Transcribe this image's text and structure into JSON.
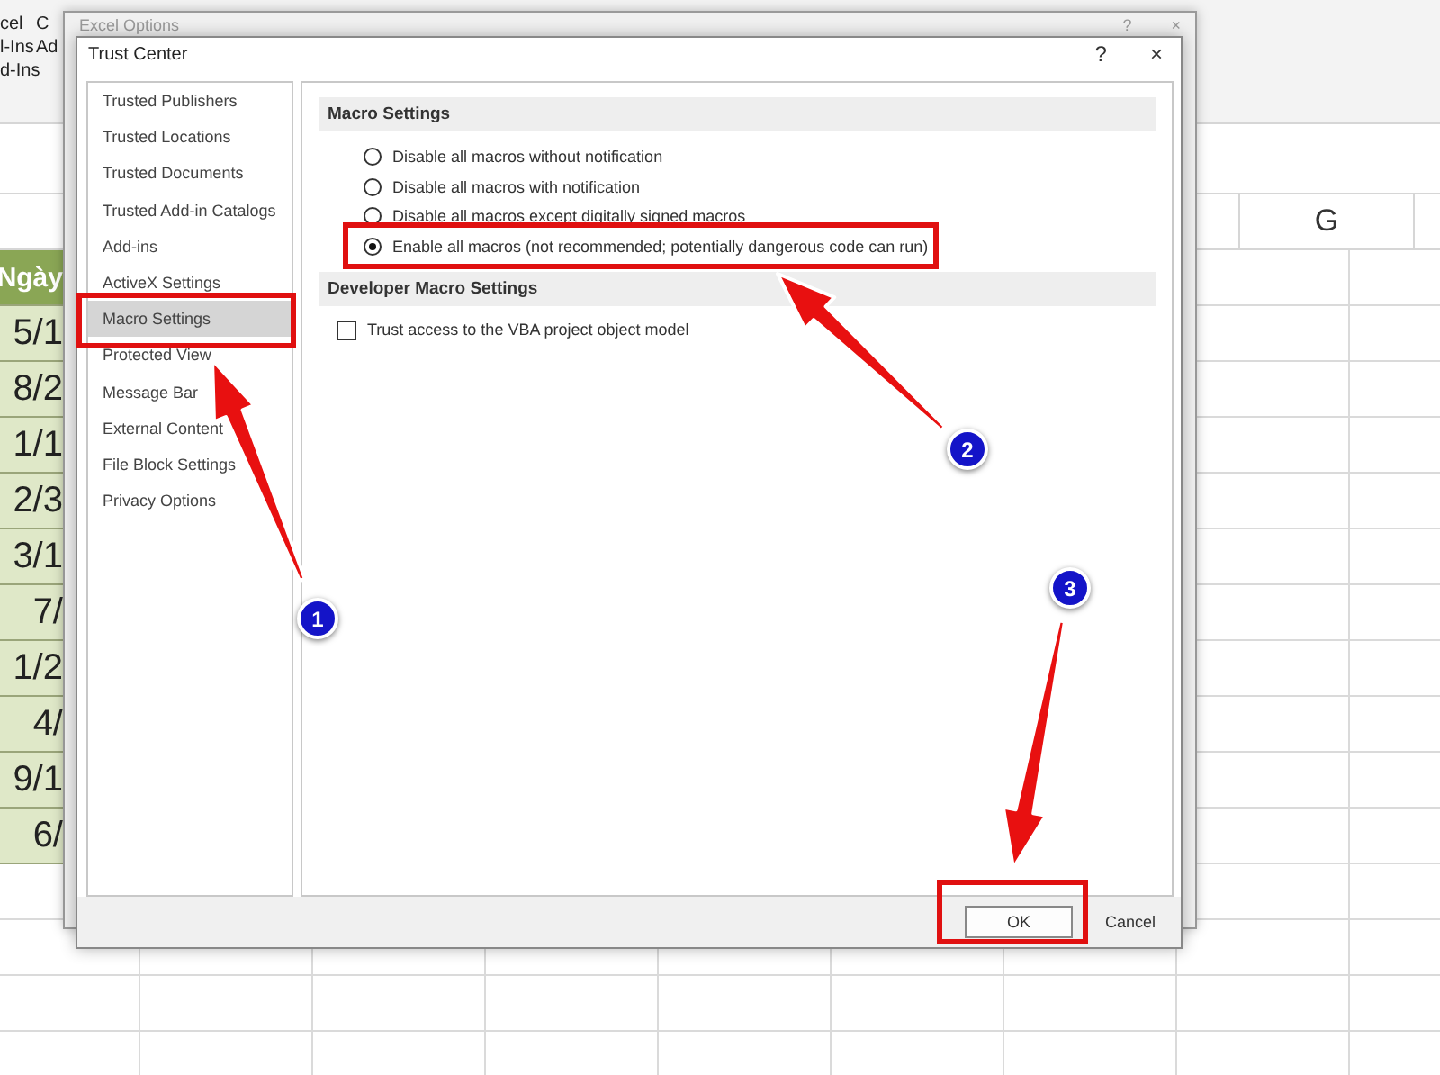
{
  "excel": {
    "ribbon_labels": [
      "cel",
      "C",
      "l-Ins",
      "Ad",
      "d-Ins"
    ],
    "column_header": "G",
    "cells": [
      {
        "text": "Ngày",
        "kind": "header"
      },
      {
        "text": "5/1",
        "kind": "value"
      },
      {
        "text": "8/2",
        "kind": "value"
      },
      {
        "text": "1/1",
        "kind": "value"
      },
      {
        "text": "2/3",
        "kind": "value"
      },
      {
        "text": "3/1",
        "kind": "value"
      },
      {
        "text": "7/",
        "kind": "value"
      },
      {
        "text": "1/2",
        "kind": "value"
      },
      {
        "text": "4/",
        "kind": "value"
      },
      {
        "text": "9/1",
        "kind": "value"
      },
      {
        "text": "6/",
        "kind": "value"
      }
    ]
  },
  "background_dialog": {
    "title": "Excel Options",
    "help": "?",
    "close": "×"
  },
  "dialog": {
    "title": "Trust Center",
    "help": "?",
    "close": "×",
    "nav": [
      {
        "label": "Trusted Publishers",
        "selected": false
      },
      {
        "label": "Trusted Locations",
        "selected": false
      },
      {
        "label": "Trusted Documents",
        "selected": false
      },
      {
        "label": "Trusted Add-in Catalogs",
        "selected": false
      },
      {
        "label": "Add-ins",
        "selected": false
      },
      {
        "label": "ActiveX Settings",
        "selected": false
      },
      {
        "label": "Macro Settings",
        "selected": true
      },
      {
        "label": "Protected View",
        "selected": false
      },
      {
        "label": "Message Bar",
        "selected": false
      },
      {
        "label": "External Content",
        "selected": false
      },
      {
        "label": "File Block Settings",
        "selected": false
      },
      {
        "label": "Privacy Options",
        "selected": false
      }
    ],
    "sections": [
      {
        "title": "Macro Settings",
        "options": [
          {
            "kind": "radio",
            "label": "Disable all macros without notification",
            "checked": false
          },
          {
            "kind": "radio",
            "label": "Disable all macros with notification",
            "checked": false
          },
          {
            "kind": "radio",
            "label": "Disable all macros except digitally signed macros",
            "checked": false
          },
          {
            "kind": "radio",
            "label": "Enable all macros (not recommended; potentially dangerous code can run)",
            "checked": true
          }
        ]
      },
      {
        "title": "Developer Macro Settings",
        "options": [
          {
            "kind": "checkbox",
            "label": "Trust access to the VBA project object model",
            "checked": false
          }
        ]
      }
    ],
    "buttons": [
      {
        "label": "OK",
        "default": true
      },
      {
        "label": "Cancel",
        "default": false
      }
    ]
  },
  "annotations": [
    {
      "number": "1"
    },
    {
      "number": "2"
    },
    {
      "number": "3"
    }
  ]
}
